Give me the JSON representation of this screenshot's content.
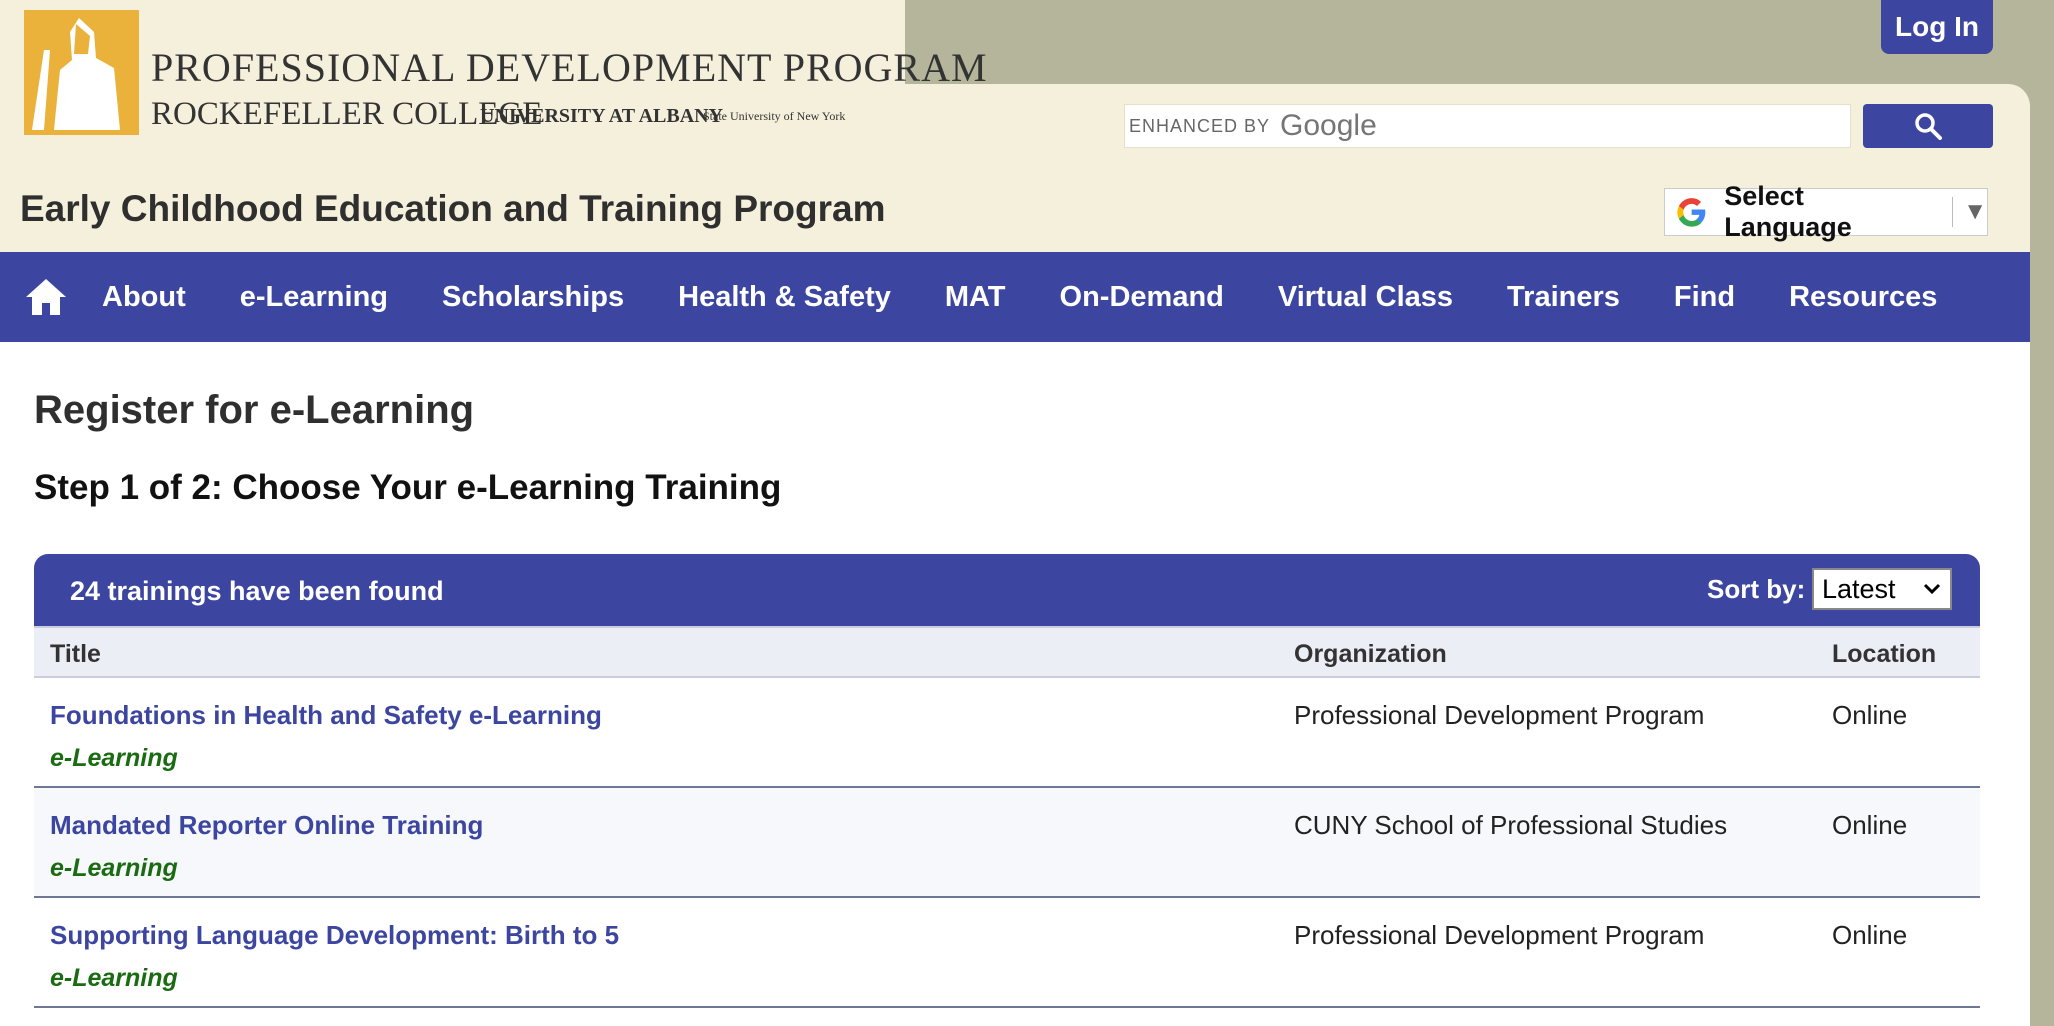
{
  "header": {
    "logo": {
      "line1": "PROFESSIONAL DEVELOPMENT PROGRAM",
      "line2": "ROCKEFELLER COLLEGE",
      "line2b": "UNIVERSITY AT ALBANY",
      "line2c": "State University of New York"
    },
    "login_label": "Log In",
    "search": {
      "enhanced_label": "ENHANCED BY",
      "google_label": "Google"
    },
    "site_title": "Early Childhood Education and Training Program",
    "language_label": "Select Language"
  },
  "nav": {
    "items": [
      "About",
      "e-Learning",
      "Scholarships",
      "Health & Safety",
      "MAT",
      "On-Demand",
      "Virtual Class",
      "Trainers",
      "Find",
      "Resources"
    ]
  },
  "main": {
    "heading": "Register for e-Learning",
    "step": "Step 1 of 2: Choose Your e-Learning Training",
    "results_count": "24 trainings have been found",
    "sort_label": "Sort by:",
    "sort_value": "Latest",
    "columns": [
      "Title",
      "Organization",
      "Location"
    ],
    "rows": [
      {
        "title": "Foundations in Health and Safety e-Learning",
        "type": "e-Learning",
        "organization": "Professional Development Program",
        "location": "Online"
      },
      {
        "title": "Mandated Reporter Online Training",
        "type": "e-Learning",
        "organization": "CUNY School of Professional Studies",
        "location": "Online"
      },
      {
        "title": "Supporting Language Development: Birth to 5",
        "type": "e-Learning",
        "organization": "Professional Development Program",
        "location": "Online"
      }
    ]
  },
  "colors": {
    "brand_blue": "#3c46a0",
    "cream": "#f5f0dc",
    "olive_bg": "#b5b59b",
    "elearning_green": "#1a6b12"
  }
}
